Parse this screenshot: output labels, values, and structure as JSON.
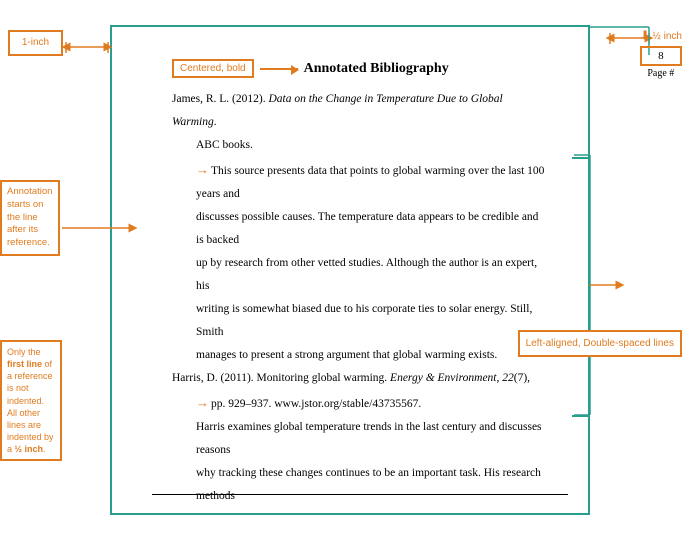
{
  "page": {
    "title": "Annotated Bibliography",
    "labels": {
      "centered_bold": "Centered, bold",
      "one_inch": "1-inch",
      "half_inch_top": "½ inch",
      "page_number": "8",
      "page_label": "Page #",
      "annotation_label": "Annotation starts on the line after its reference.",
      "indent_label": "Only the first line of a reference is not indented. All other lines are indented by a ½ inch.",
      "right_label": "Left-aligned, Double-spaced lines"
    },
    "references": [
      {
        "id": "ref1",
        "citation": "James, R. L. (2012). ",
        "citation_italic": "Data on the Change in Temperature Due to Global Warming",
        "citation_end": ". ABC books.",
        "annotation_lines": [
          "This source presents data that points to global warming over the last 100 years and",
          "discusses possible causes. The temperature data appears to be credible and is backed",
          "up by research from other vetted studies. Although the author is an expert, his",
          "writing is somewhat biased due to his corporate ties to solar energy. Still, Smith",
          "manages to present a strong argument that global warming exists."
        ]
      },
      {
        "id": "ref2",
        "citation_start": "Harris, D. (2011). Monitoring global warming. ",
        "citation_italic": "Energy & Environment",
        "citation_end": ", 22(7),",
        "citation_line2": "pp. 929–937. www.jstor.org/stable/43735567.",
        "annotation_lines": [
          "Harris examines global temperature trends in the last century and discusses reasons",
          "why tracking these changes continues to be an important task. His research methods"
        ]
      }
    ]
  }
}
